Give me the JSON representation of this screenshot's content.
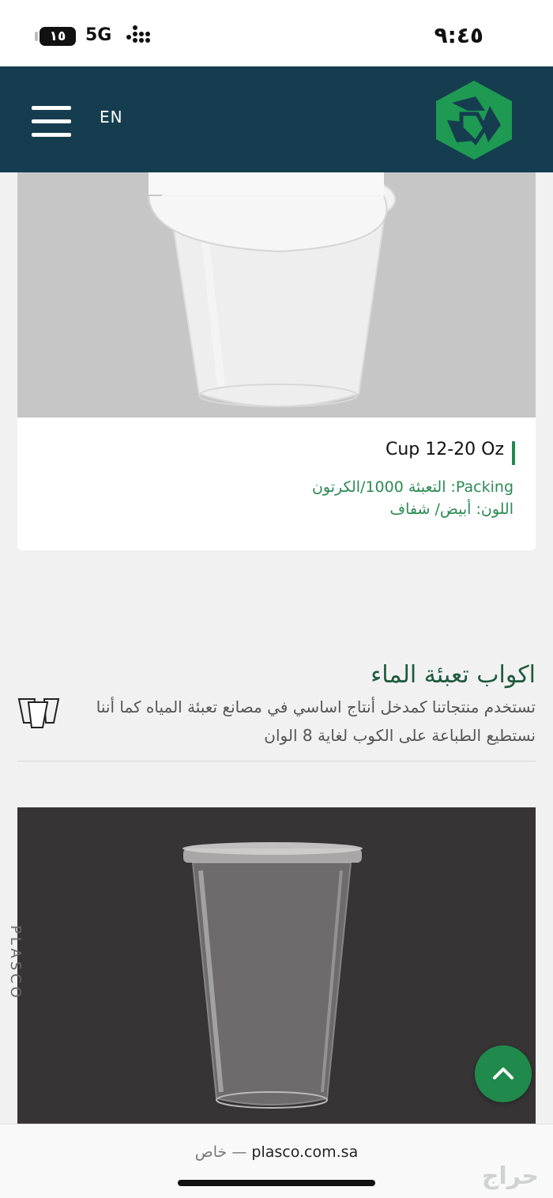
{
  "status_bar": {
    "battery": "١٥",
    "network": "5G",
    "time": "٩:٤٥"
  },
  "header": {
    "lang_toggle": "EN",
    "logo": "plasco-logo",
    "colors": {
      "background": "#153d4f",
      "logo_green": "#1e9a52"
    }
  },
  "product1": {
    "name": "Cup 12-20 Oz",
    "packing": "Packing: التعبئة 1000/الكرتون",
    "color_line": "اللون: أبيض/ شفاف"
  },
  "section": {
    "title": "اكواب تعبئة الماء",
    "description": "تستخدم منتجاتنا كمدخل أنتاج اساسي في مصانع تعبئة المياه كما أننا نستطيع الطباعة على الكوب لغاية 8 الوان",
    "icon": "cups-icon"
  },
  "product2": {
    "watermark": "PLASCO"
  },
  "scroll_top": {
    "icon": "chevron-up-icon",
    "color": "#1f8a4c"
  },
  "browser": {
    "domain": "plasco.com.sa",
    "separator": " — ",
    "private_label": "خاص",
    "haraj_watermark": "حراج"
  }
}
